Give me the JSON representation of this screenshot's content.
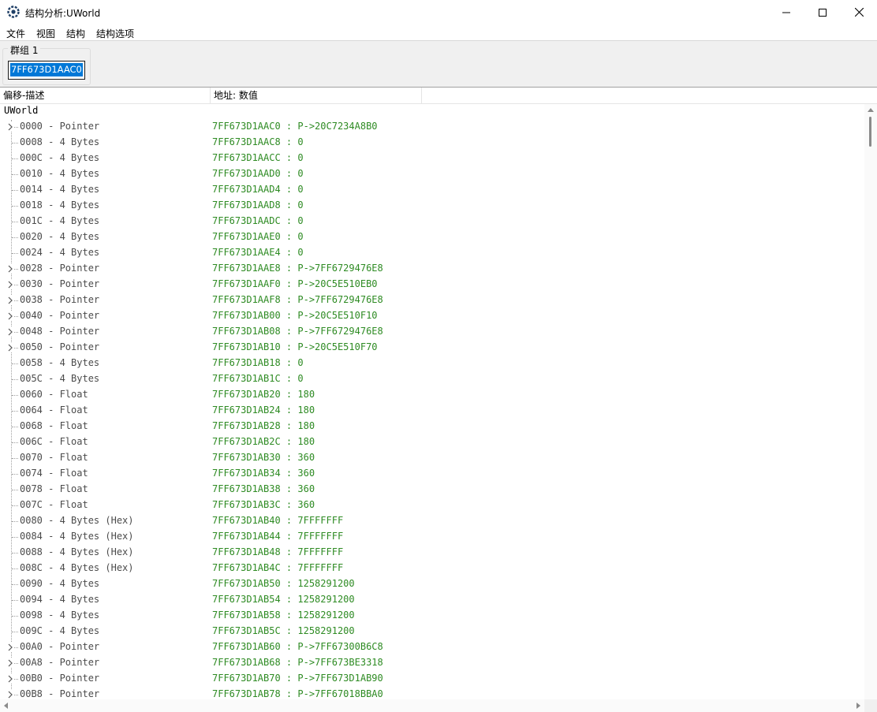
{
  "window": {
    "title": "结构分析:UWorld"
  },
  "menu": [
    "文件",
    "视图",
    "结构",
    "结构选项"
  ],
  "group": {
    "label": "群组 1",
    "address": "7FF673D1AAC0"
  },
  "columns": [
    "偏移-描述",
    "地址: 数值"
  ],
  "tree": {
    "root": "UWorld",
    "rows": [
      {
        "offset": "0000 - Pointer",
        "value": "7FF673D1AAC0 : P->20C7234A8B0",
        "expandable": true
      },
      {
        "offset": "0008 - 4 Bytes",
        "value": "7FF673D1AAC8 : 0",
        "expandable": false
      },
      {
        "offset": "000C - 4 Bytes",
        "value": "7FF673D1AACC : 0",
        "expandable": false
      },
      {
        "offset": "0010 - 4 Bytes",
        "value": "7FF673D1AAD0 : 0",
        "expandable": false
      },
      {
        "offset": "0014 - 4 Bytes",
        "value": "7FF673D1AAD4 : 0",
        "expandable": false
      },
      {
        "offset": "0018 - 4 Bytes",
        "value": "7FF673D1AAD8 : 0",
        "expandable": false
      },
      {
        "offset": "001C - 4 Bytes",
        "value": "7FF673D1AADC : 0",
        "expandable": false
      },
      {
        "offset": "0020 - 4 Bytes",
        "value": "7FF673D1AAE0 : 0",
        "expandable": false
      },
      {
        "offset": "0024 - 4 Bytes",
        "value": "7FF673D1AAE4 : 0",
        "expandable": false
      },
      {
        "offset": "0028 - Pointer",
        "value": "7FF673D1AAE8 : P->7FF6729476E8",
        "expandable": true
      },
      {
        "offset": "0030 - Pointer",
        "value": "7FF673D1AAF0 : P->20C5E510EB0",
        "expandable": true
      },
      {
        "offset": "0038 - Pointer",
        "value": "7FF673D1AAF8 : P->7FF6729476E8",
        "expandable": true
      },
      {
        "offset": "0040 - Pointer",
        "value": "7FF673D1AB00 : P->20C5E510F10",
        "expandable": true
      },
      {
        "offset": "0048 - Pointer",
        "value": "7FF673D1AB08 : P->7FF6729476E8",
        "expandable": true
      },
      {
        "offset": "0050 - Pointer",
        "value": "7FF673D1AB10 : P->20C5E510F70",
        "expandable": true
      },
      {
        "offset": "0058 - 4 Bytes",
        "value": "7FF673D1AB18 : 0",
        "expandable": false
      },
      {
        "offset": "005C - 4 Bytes",
        "value": "7FF673D1AB1C : 0",
        "expandable": false
      },
      {
        "offset": "0060 - Float",
        "value": "7FF673D1AB20 : 180",
        "expandable": false
      },
      {
        "offset": "0064 - Float",
        "value": "7FF673D1AB24 : 180",
        "expandable": false
      },
      {
        "offset": "0068 - Float",
        "value": "7FF673D1AB28 : 180",
        "expandable": false
      },
      {
        "offset": "006C - Float",
        "value": "7FF673D1AB2C : 180",
        "expandable": false
      },
      {
        "offset": "0070 - Float",
        "value": "7FF673D1AB30 : 360",
        "expandable": false
      },
      {
        "offset": "0074 - Float",
        "value": "7FF673D1AB34 : 360",
        "expandable": false
      },
      {
        "offset": "0078 - Float",
        "value": "7FF673D1AB38 : 360",
        "expandable": false
      },
      {
        "offset": "007C - Float",
        "value": "7FF673D1AB3C : 360",
        "expandable": false
      },
      {
        "offset": "0080 - 4 Bytes (Hex)",
        "value": "7FF673D1AB40 : 7FFFFFFF",
        "expandable": false
      },
      {
        "offset": "0084 - 4 Bytes (Hex)",
        "value": "7FF673D1AB44 : 7FFFFFFF",
        "expandable": false
      },
      {
        "offset": "0088 - 4 Bytes (Hex)",
        "value": "7FF673D1AB48 : 7FFFFFFF",
        "expandable": false
      },
      {
        "offset": "008C - 4 Bytes (Hex)",
        "value": "7FF673D1AB4C : 7FFFFFFF",
        "expandable": false
      },
      {
        "offset": "0090 - 4 Bytes",
        "value": "7FF673D1AB50 : 1258291200",
        "expandable": false
      },
      {
        "offset": "0094 - 4 Bytes",
        "value": "7FF673D1AB54 : 1258291200",
        "expandable": false
      },
      {
        "offset": "0098 - 4 Bytes",
        "value": "7FF673D1AB58 : 1258291200",
        "expandable": false
      },
      {
        "offset": "009C - 4 Bytes",
        "value": "7FF673D1AB5C : 1258291200",
        "expandable": false
      },
      {
        "offset": "00A0 - Pointer",
        "value": "7FF673D1AB60 : P->7FF67300B6C8",
        "expandable": true
      },
      {
        "offset": "00A8 - Pointer",
        "value": "7FF673D1AB68 : P->7FF673BE3318",
        "expandable": true
      },
      {
        "offset": "00B0 - Pointer",
        "value": "7FF673D1AB70 : P->7FF673D1AB90",
        "expandable": true
      },
      {
        "offset": "00B8 - Pointer",
        "value": "7FF673D1AB78 : P->7FF67018BBA0",
        "expandable": true
      }
    ]
  },
  "icons": {
    "app": "cheat-engine-icon",
    "minimize": "minimize-icon",
    "maximize": "maximize-icon",
    "close": "close-icon",
    "expand": "chevron-right-icon"
  },
  "colors": {
    "value_text": "#2e8b23",
    "offset_text": "#4b4b4b",
    "selection": "#0078d7"
  }
}
